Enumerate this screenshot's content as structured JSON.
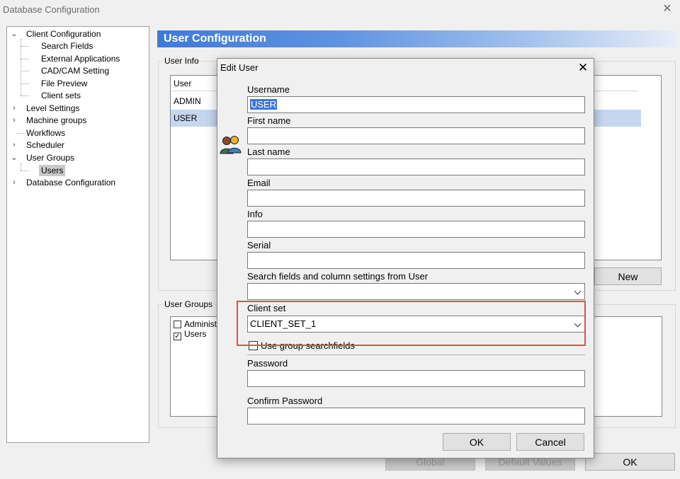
{
  "window": {
    "title": "Database Configuration",
    "close": "✕"
  },
  "tree": {
    "nodes": [
      {
        "label": "Client Configuration",
        "toggle": "⌄"
      },
      {
        "label": "Search Fields"
      },
      {
        "label": "External Applications"
      },
      {
        "label": "CAD/CAM Setting"
      },
      {
        "label": "File Preview"
      },
      {
        "label": "Client sets"
      },
      {
        "label": "Level Settings",
        "toggle": "›"
      },
      {
        "label": "Machine groups",
        "toggle": "›"
      },
      {
        "label": "Workflows"
      },
      {
        "label": "Scheduler",
        "toggle": "›"
      },
      {
        "label": "User Groups",
        "toggle": "⌄"
      },
      {
        "label": "Users"
      },
      {
        "label": "Database Configuration",
        "toggle": "›"
      }
    ]
  },
  "panel": {
    "header": "User Configuration",
    "user_info_label": "User Info",
    "user_column": "User",
    "users": [
      "ADMIN",
      "USER"
    ],
    "new_button": "New",
    "user_groups_label": "User Groups",
    "groups": [
      {
        "label": "Administr",
        "checked": false
      },
      {
        "label": "Users",
        "checked": true,
        "mark": "✓"
      }
    ],
    "global_button": "Global",
    "default_values_button": "Default Values",
    "ok_button": "OK"
  },
  "dialog": {
    "title": "Edit User",
    "close": "✕",
    "icon": "users-icon",
    "fields": {
      "username_label": "Username",
      "username_value": "USER",
      "firstname_label": "First name",
      "lastname_label": "Last name",
      "email_label": "Email",
      "info_label": "Info",
      "serial_label": "Serial",
      "search_fields_label": "Search fields and column settings from User",
      "client_set_label": "Client set",
      "client_set_value": "CLIENT_SET_1",
      "use_group_label": "Use group searchfields",
      "password_label": "Password",
      "confirm_password_label": "Confirm Password"
    },
    "ok_button": "OK",
    "cancel_button": "Cancel"
  },
  "colors": {
    "accent": "#3d7ad8",
    "selection": "#c5d6ef",
    "highlight_box": "#d9534f"
  }
}
